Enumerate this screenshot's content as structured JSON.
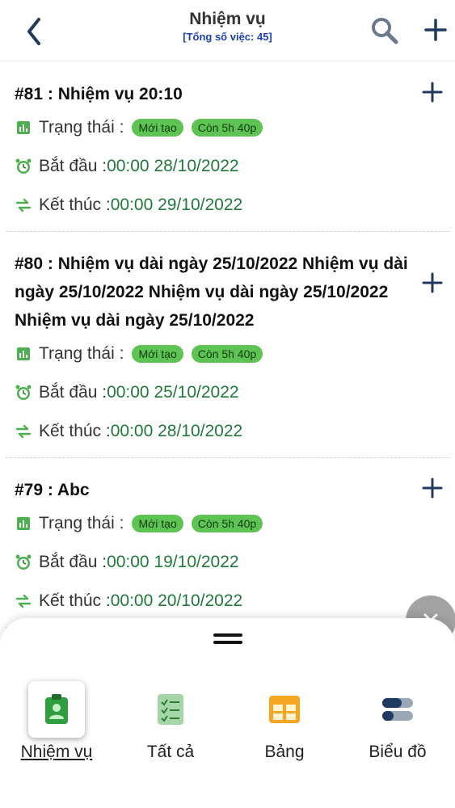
{
  "header": {
    "title": "Nhiệm vụ",
    "subtitle": "[Tổng số việc: 45]"
  },
  "tasks": [
    {
      "title": "#81 : Nhiệm vụ 20:10",
      "status_label": "Trạng thái :",
      "status_badge": "Mới tạo",
      "time_badge": "Còn 5h 40p",
      "start_label": "Bắt đầu :",
      "start_value": "00:00 28/10/2022",
      "end_label": "Kết thúc :",
      "end_value": "00:00 29/10/2022"
    },
    {
      "title": "#80 : Nhiệm vụ dài ngày 25/10/2022 Nhiệm vụ dài ngày 25/10/2022 Nhiệm vụ dài ngày 25/10/2022 Nhiệm vụ dài ngày 25/10/2022",
      "status_label": "Trạng thái :",
      "status_badge": "Mới tạo",
      "time_badge": "Còn 5h 40p",
      "start_label": "Bắt đầu :",
      "start_value": "00:00 25/10/2022",
      "end_label": "Kết thúc :",
      "end_value": "00:00 28/10/2022"
    },
    {
      "title": "#79 : Abc",
      "status_label": "Trạng thái :",
      "status_badge": "Mới tạo",
      "time_badge": "Còn 5h 40p",
      "start_label": "Bắt đầu :",
      "start_value": "00:00 19/10/2022",
      "end_label": "Kết thúc :",
      "end_value": "00:00 20/10/2022"
    }
  ],
  "bottom_nav": {
    "items": [
      {
        "label": "Nhiệm vụ",
        "icon": "clipboard-user-icon",
        "active": true
      },
      {
        "label": "Tất cả",
        "icon": "checklist-icon",
        "active": false
      },
      {
        "label": "Bảng",
        "icon": "table-icon",
        "active": false
      },
      {
        "label": "Biểu đồ",
        "icon": "toggle-chart-icon",
        "active": false
      }
    ]
  },
  "colors": {
    "accent_blue": "#1f3a5f",
    "badge_green": "#5dc352",
    "date_green": "#1f7a3a",
    "subtitle_blue": "#1a3fb5"
  }
}
